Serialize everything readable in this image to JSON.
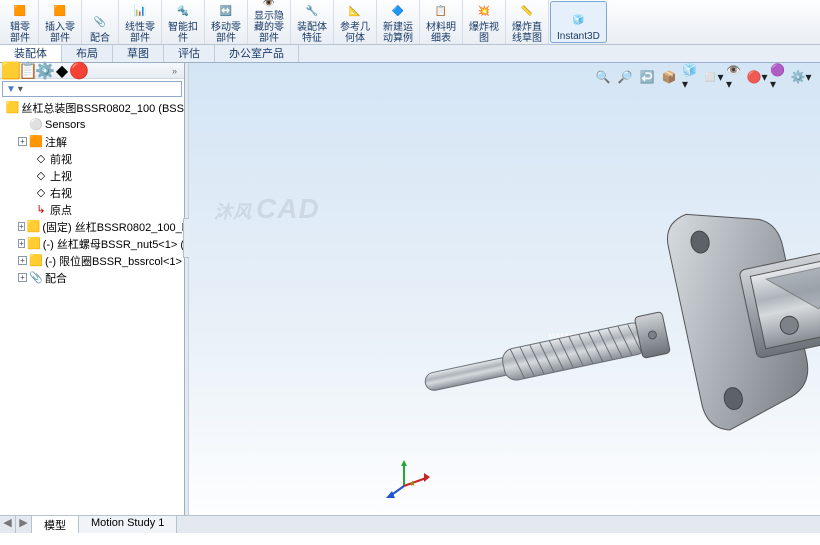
{
  "ribbon": {
    "items": [
      {
        "label": "辑零\n部件"
      },
      {
        "label": "插入零\n部件"
      },
      {
        "label": "配合"
      },
      {
        "label": "线性零\n部件"
      },
      {
        "label": "智能扣\n件"
      },
      {
        "label": "移动零\n部件"
      },
      {
        "label": "显示隐\n藏的零\n部件"
      },
      {
        "label": "装配体\n特征"
      },
      {
        "label": "参考几\n何体"
      },
      {
        "label": "新建运\n动算例"
      },
      {
        "label": "材料明\n细表"
      },
      {
        "label": "爆炸视\n图"
      },
      {
        "label": "爆炸直\n线草图"
      },
      {
        "label": "Instant3D"
      }
    ]
  },
  "tabs": {
    "items": [
      "装配体",
      "布局",
      "草图",
      "评估",
      "办公室产品"
    ]
  },
  "filter_placeholder": "▾",
  "tree": {
    "root": "丝杠总装图BSSR0802_100  (BSS",
    "sensors": "Sensors",
    "annotations": "注解",
    "front": "前视",
    "top": "上视",
    "right": "右视",
    "origin": "原点",
    "part1": "(固定) 丝杠BSSR0802_100_b·",
    "part2": "(-) 丝杠螺母BSSR_nut5<1> (",
    "part3": "(-) 限位圈BSSR_bssrcol<1>",
    "mates": "配合"
  },
  "bottom_tabs": {
    "model": "模型",
    "motion": "Motion Study 1"
  },
  "watermark_brand_prefix": "沐风",
  "watermark_brand_suffix": "CAD",
  "watermark_url": "www.mfcad.com"
}
